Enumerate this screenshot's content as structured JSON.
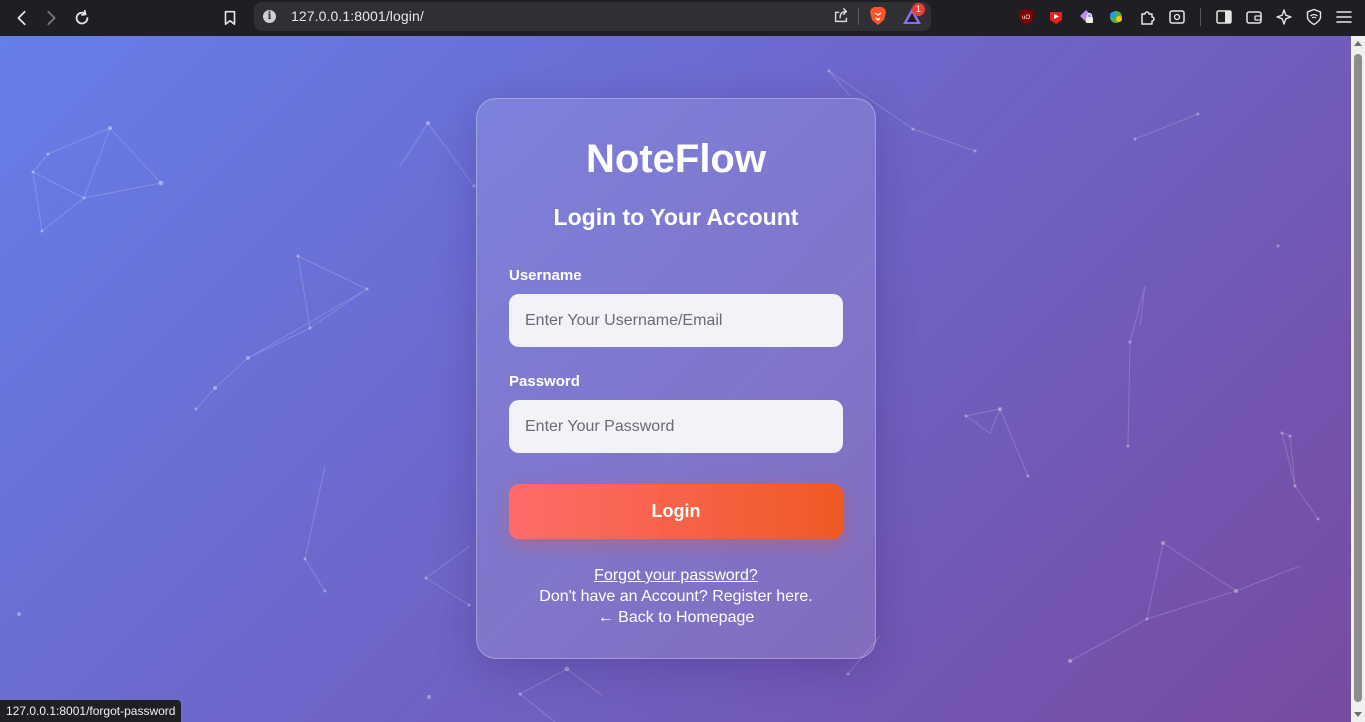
{
  "browser": {
    "url": "127.0.0.1:8001/login/",
    "rewards_badge": "1",
    "status_url": "127.0.0.1:8001/forgot-password"
  },
  "login": {
    "brand": "NoteFlow",
    "title": "Login to Your Account",
    "username_label": "Username",
    "username_placeholder": "Enter Your Username/Email",
    "password_label": "Password",
    "password_placeholder": "Enter Your Password",
    "submit_label": "Login",
    "forgot_link": "Forgot your password?",
    "register_link": "Don't have an Account? Register here.",
    "back_link": "← Back to Homepage"
  },
  "colors": {
    "bg_start": "#667eea",
    "bg_end": "#764ba2",
    "button_start": "#ff6b6b",
    "button_end": "#ee5a24"
  },
  "icons": [
    "back-icon",
    "forward-icon",
    "reload-icon",
    "bookmark-icon",
    "site-info-icon",
    "share-icon",
    "brave-shields-icon",
    "brave-rewards-icon",
    "ublock-icon",
    "youtube-ext-icon",
    "lock-ext-icon",
    "color-ext-icon",
    "extensions-icon",
    "screenshot-ext-icon",
    "sidebar-icon",
    "wallet-icon",
    "leo-ai-icon",
    "vpn-icon",
    "menu-icon"
  ]
}
